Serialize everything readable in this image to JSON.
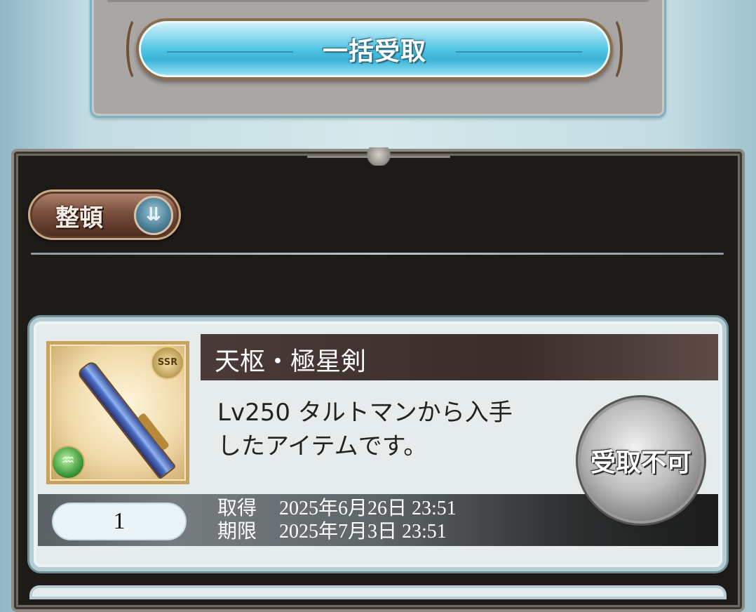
{
  "top": {
    "bulk_receive_label": "一括受取"
  },
  "toolbar": {
    "sort_label": "整頓",
    "sort_icon": "double-chevron-down-icon"
  },
  "item": {
    "name": "天枢・極星剣",
    "rarity": "SSR",
    "description": "Lv250 タルトマンから入手\nしたアイテムです。",
    "status_label": "受取不可",
    "quantity": "1",
    "acquired_label": "取得",
    "acquired_value": "2025年6月26日 23:51",
    "expiry_label": "期限",
    "expiry_value": "2025年7月3日 23:51"
  },
  "colors": {
    "button_blue": "#53c6e6",
    "frame_dark": "#1e1a17",
    "name_bar": "#3b2d2a",
    "card_bg": "#e6ecec"
  }
}
